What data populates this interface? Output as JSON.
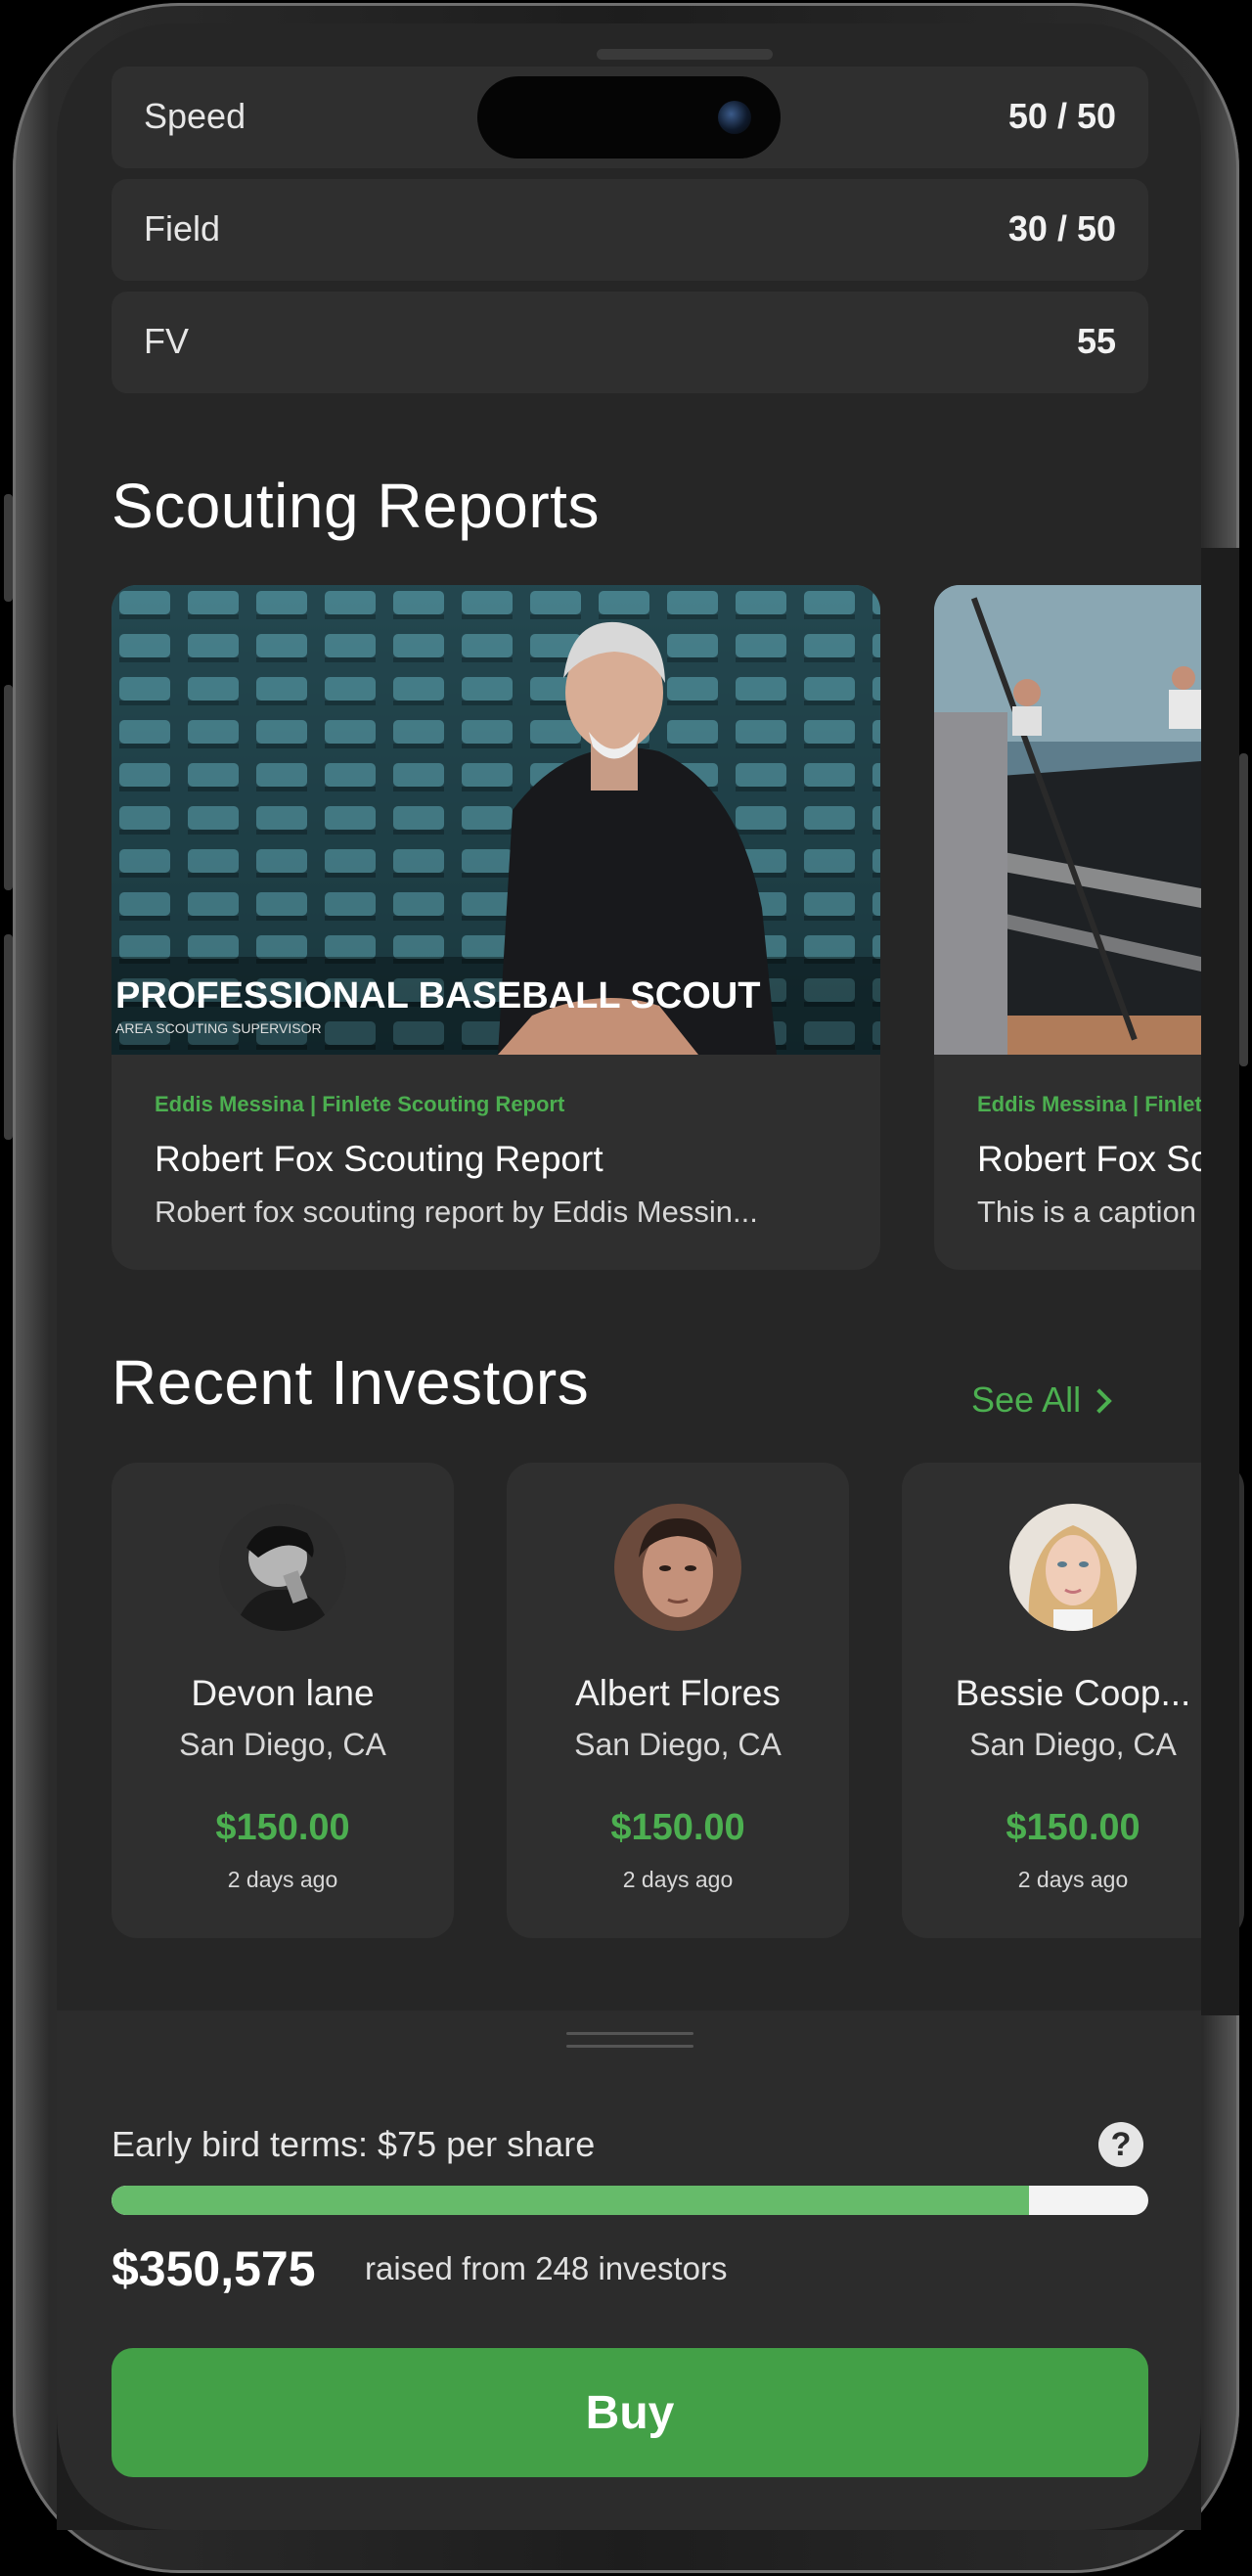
{
  "stats": [
    {
      "label": "Speed",
      "value": "50 / 50"
    },
    {
      "label": "Field",
      "value": "30 / 50"
    },
    {
      "label": "FV",
      "value": "55"
    }
  ],
  "scouting": {
    "title": "Scouting Reports",
    "cards": [
      {
        "image_headline": "PROFESSIONAL BASEBALL SCOUT",
        "image_subline": "AREA SCOUTING SUPERVISOR",
        "tag": "Eddis Messina | Finlete Scouting Report",
        "title": "Robert Fox Scouting Report",
        "caption": "Robert fox scouting report by Eddis Messin..."
      },
      {
        "tag": "Eddis Messina | Finlete Scouting Report",
        "title": "Robert Fox Scouting Report",
        "caption": "This is a caption"
      }
    ]
  },
  "investors": {
    "title": "Recent Investors",
    "see_all": "See All",
    "items": [
      {
        "name": "Devon lane",
        "location": "San Diego, CA",
        "amount": "$150.00",
        "time": "2 days ago"
      },
      {
        "name": "Albert Flores",
        "location": "San Diego, CA",
        "amount": "$150.00",
        "time": "2 days ago"
      },
      {
        "name": "Bessie Coop...",
        "location": "San Diego, CA",
        "amount": "$150.00",
        "time": "2 days ago"
      }
    ]
  },
  "funding": {
    "terms": "Early bird terms: $75 per share",
    "help_symbol": "?",
    "progress_fraction": 0.885,
    "raised_amount": "$350,575",
    "raised_text": "raised from 248 investors",
    "buy_label": "Buy"
  },
  "colors": {
    "accent_green": "#4caf50",
    "progress_green": "#66bb6a",
    "card_bg": "#2f2f2f",
    "screen_bg": "#262626"
  }
}
